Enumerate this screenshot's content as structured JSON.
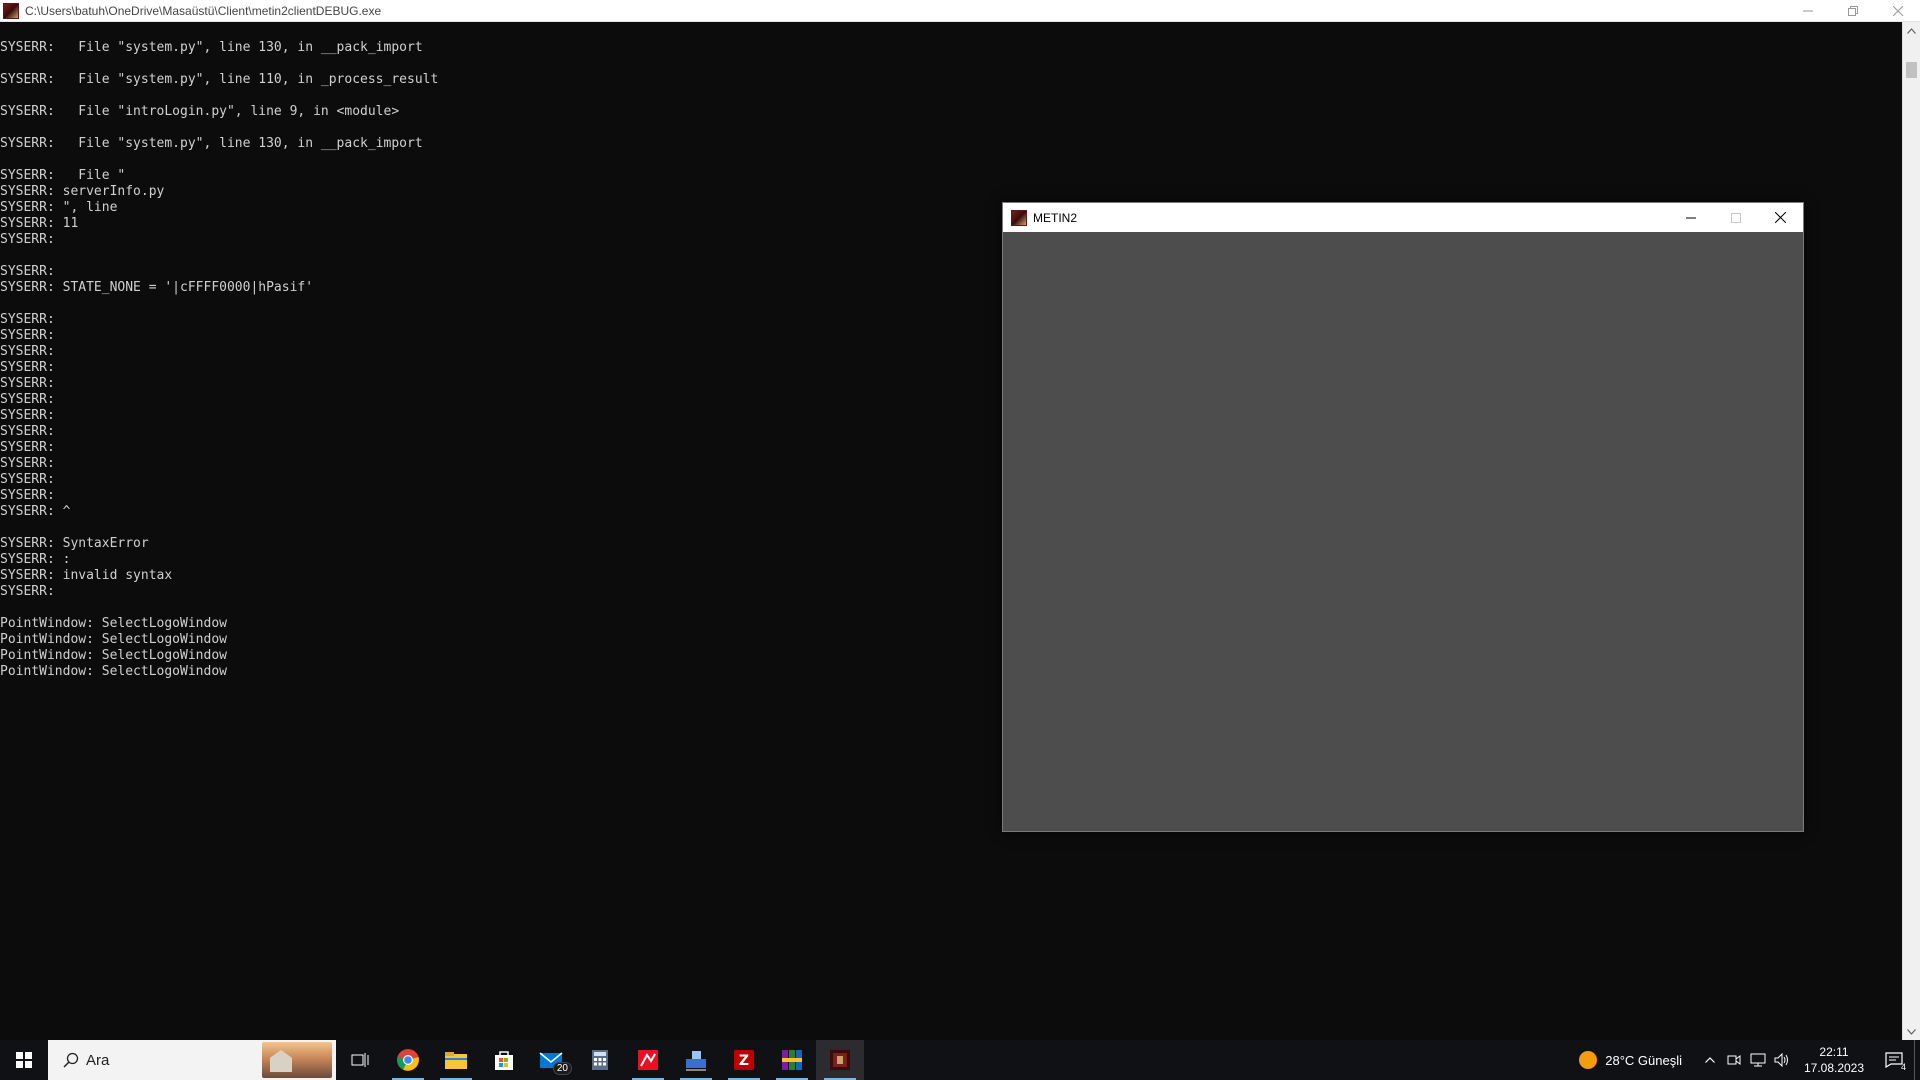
{
  "console": {
    "title": "C:\\Users\\batuh\\OneDrive\\Masaüstü\\Client\\metin2clientDEBUG.exe",
    "lines": [
      "SYSERR:   File \"system.py\", line 130, in __pack_import",
      "",
      "SYSERR:   File \"system.py\", line 110, in _process_result",
      "",
      "SYSERR:   File \"introLogin.py\", line 9, in <module>",
      "",
      "SYSERR:   File \"system.py\", line 130, in __pack_import",
      "",
      "SYSERR:   File \"",
      "SYSERR: serverInfo.py",
      "SYSERR: \", line",
      "SYSERR: 11",
      "SYSERR:",
      "",
      "SYSERR:",
      "SYSERR: STATE_NONE = '|cFFFF0000|hPasif'",
      "",
      "SYSERR:",
      "SYSERR:",
      "SYSERR:",
      "SYSERR:",
      "SYSERR:",
      "SYSERR:",
      "SYSERR:",
      "SYSERR:",
      "SYSERR:",
      "SYSERR:",
      "SYSERR:",
      "SYSERR:",
      "SYSERR: ^",
      "",
      "SYSERR: SyntaxError",
      "SYSERR: :",
      "SYSERR: invalid syntax",
      "SYSERR:",
      "",
      "PointWindow: SelectLogoWindow",
      "PointWindow: SelectLogoWindow",
      "PointWindow: SelectLogoWindow",
      "PointWindow: SelectLogoWindow"
    ]
  },
  "game_window": {
    "title": "METIN2"
  },
  "taskbar": {
    "search_placeholder": "Ara",
    "mail_badge": "20",
    "weather": "28°C  Güneşli",
    "time": "22:11",
    "date": "17.08.2023",
    "notification_count": "4",
    "pinned": [
      {
        "name": "task-view-icon"
      },
      {
        "name": "chrome-icon"
      },
      {
        "name": "file-explorer-icon"
      },
      {
        "name": "store-icon"
      },
      {
        "name": "mail-icon"
      },
      {
        "name": "calculator-icon"
      },
      {
        "name": "app-red-icon"
      },
      {
        "name": "network-tool-icon"
      },
      {
        "name": "filezilla-icon"
      },
      {
        "name": "winrar-icon"
      },
      {
        "name": "metin2-icon"
      }
    ]
  }
}
